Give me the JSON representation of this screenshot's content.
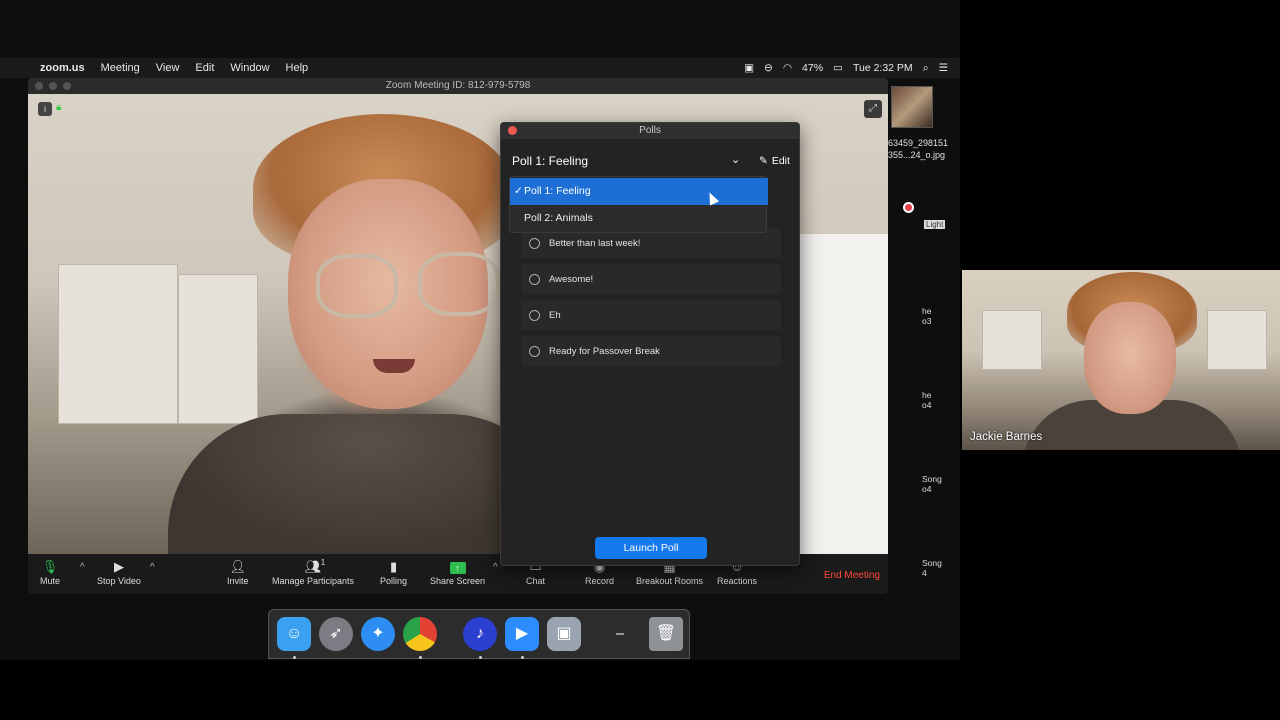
{
  "menubar": {
    "app_name": "zoom.us",
    "items": [
      "Meeting",
      "View",
      "Edit",
      "Window",
      "Help"
    ],
    "battery": "47%",
    "clock": "Tue 2:32 PM"
  },
  "zoom": {
    "window_title": "Zoom Meeting ID: 812-979-5798",
    "toolbar": {
      "mute": "Mute",
      "stop_video": "Stop Video",
      "invite": "Invite",
      "manage_participants": "Manage Participants",
      "participant_count": "1",
      "polling": "Polling",
      "share_screen": "Share Screen",
      "chat": "Chat",
      "record": "Record",
      "breakout_rooms": "Breakout Rooms",
      "reactions": "Reactions",
      "end_meeting": "End Meeting"
    }
  },
  "polls": {
    "window_title": "Polls",
    "selected_poll": "Poll 1: Feeling",
    "edit_label": "Edit",
    "dropdown_options": [
      {
        "label": "Poll 1: Feeling",
        "selected": true
      },
      {
        "label": "Poll 2: Animals",
        "selected": false
      }
    ],
    "answers": [
      "Better than last week!",
      "Awesome!",
      "Eh",
      "Ready for Passover Break"
    ],
    "launch_label": "Launch Poll"
  },
  "desktop": {
    "file_name_line1": "63459_298151",
    "file_name_line2": "355...24_o.jpg"
  },
  "gallery": {
    "light_tag": "Light",
    "names": [
      {
        "line1": "he",
        "line2": "o3"
      },
      {
        "line1": "he",
        "line2": "o4"
      },
      {
        "line1": "Song",
        "line2": "o4"
      },
      {
        "line1": "Song",
        "line2": "4"
      }
    ]
  },
  "self_view": {
    "name": "Jackie Barnes"
  },
  "colors": {
    "accent_blue": "#1d6fd6",
    "launch_blue": "#1479ea",
    "end_red": "#ff4a3a",
    "share_green": "#2dbe4e"
  }
}
